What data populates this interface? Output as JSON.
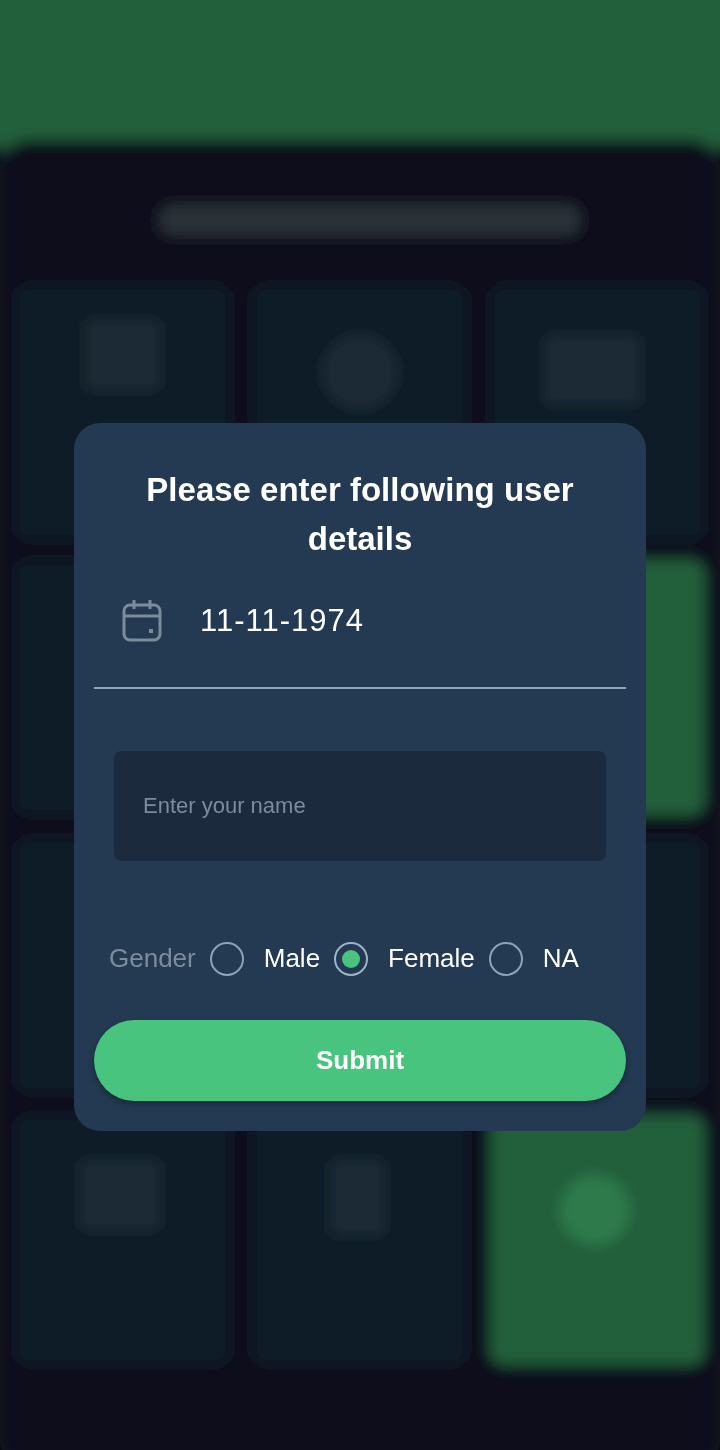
{
  "dialog": {
    "title": "Please enter following user details",
    "date_field": {
      "value": "11-11-1974"
    },
    "name_field": {
      "placeholder": "Enter your name"
    },
    "gender": {
      "label": "Gender",
      "options": [
        {
          "label": "Male",
          "selected": false
        },
        {
          "label": "Female",
          "selected": true
        },
        {
          "label": "NA",
          "selected": false
        }
      ]
    },
    "submit": {
      "label": "Submit"
    }
  }
}
